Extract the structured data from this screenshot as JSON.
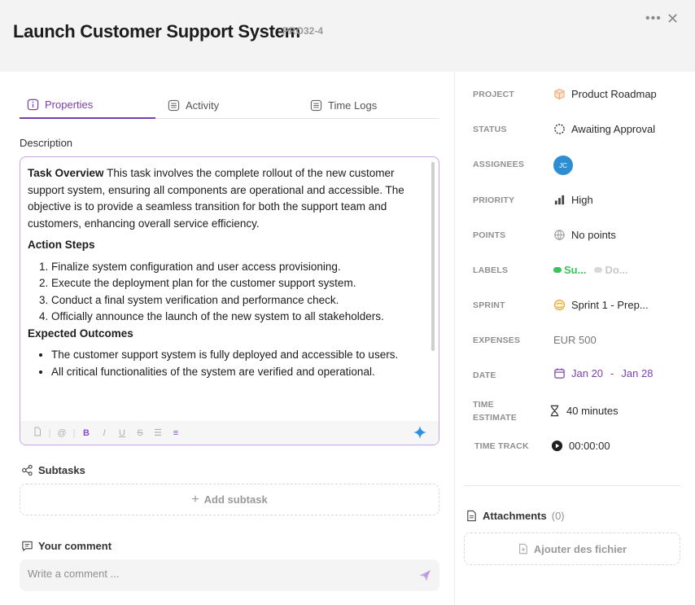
{
  "header": {
    "title": "Launch Customer Support System",
    "task_id": "PRO32-4",
    "more_glyph": "•••",
    "close_glyph": "✕"
  },
  "tabs": [
    {
      "label": "Properties",
      "icon": "info-icon",
      "active": true
    },
    {
      "label": "Activity",
      "icon": "list-icon",
      "active": false
    },
    {
      "label": "Time Logs",
      "icon": "list-icon",
      "active": false
    }
  ],
  "description": {
    "label": "Description",
    "overview_title": "Task Overview",
    "overview_text": " This task involves the complete rollout of the new customer support system, ensuring all components are operational and accessible. The objective is to provide a seamless transition for both the support team and customers, enhancing overall service efficiency.",
    "action_title": "Action Steps",
    "action_steps": [
      "Finalize system configuration and user access provisioning.",
      "Execute the deployment plan for the customer support system.",
      "Conduct a final system verification and performance check.",
      "Officially announce the launch of the new system to all stakeholders."
    ],
    "outcomes_title": "Expected Outcomes",
    "outcomes": [
      "The customer support system is fully deployed and accessible to users.",
      "All critical functionalities of the system are verified and operational."
    ],
    "toolbar": {
      "bold": "B",
      "italic": "I",
      "underline": "U",
      "strike": "S",
      "bullets": "☰",
      "numbered": "≡",
      "mention": "@",
      "separator": "|"
    }
  },
  "subtasks": {
    "label": "Subtasks",
    "add_label": "Add subtask",
    "add_glyph": "+"
  },
  "comment": {
    "label": "Your comment",
    "placeholder": "Write a comment ..."
  },
  "properties": {
    "project": {
      "label": "PROJECT",
      "value": "Product Roadmap"
    },
    "status": {
      "label": "STATUS",
      "value": "Awaiting Approval"
    },
    "assignees": {
      "label": "ASSIGNEES",
      "initials": "JC"
    },
    "priority": {
      "label": "PRIORITY",
      "value": "High"
    },
    "points": {
      "label": "POINTS",
      "value": "No points"
    },
    "labels": {
      "label": "LABELS",
      "items": [
        {
          "text": "Su...",
          "color": "#3cc35a"
        },
        {
          "text": "Do...",
          "color": "#d9d9d9"
        }
      ]
    },
    "sprint": {
      "label": "SPRINT",
      "value": "Sprint 1 - Prep..."
    },
    "expenses": {
      "label": "EXPENSES",
      "value": "EUR 500"
    },
    "date": {
      "label": "DATE",
      "start": "Jan 20",
      "separator": "-",
      "end": "Jan 28"
    },
    "time_estimate": {
      "label_line1": "TIME",
      "label_line2": "ESTIMATE",
      "value": "40 minutes"
    },
    "time_track": {
      "label": "TIME TRACK",
      "value": "00:00:00"
    }
  },
  "attachments": {
    "label": "Attachments",
    "count": "(0)",
    "add_label": "Ajouter des fichier"
  },
  "colors": {
    "accent": "#7b3fae",
    "assignee_avatar": "#2d8ed1",
    "sparkle": "#2f8fe0"
  }
}
